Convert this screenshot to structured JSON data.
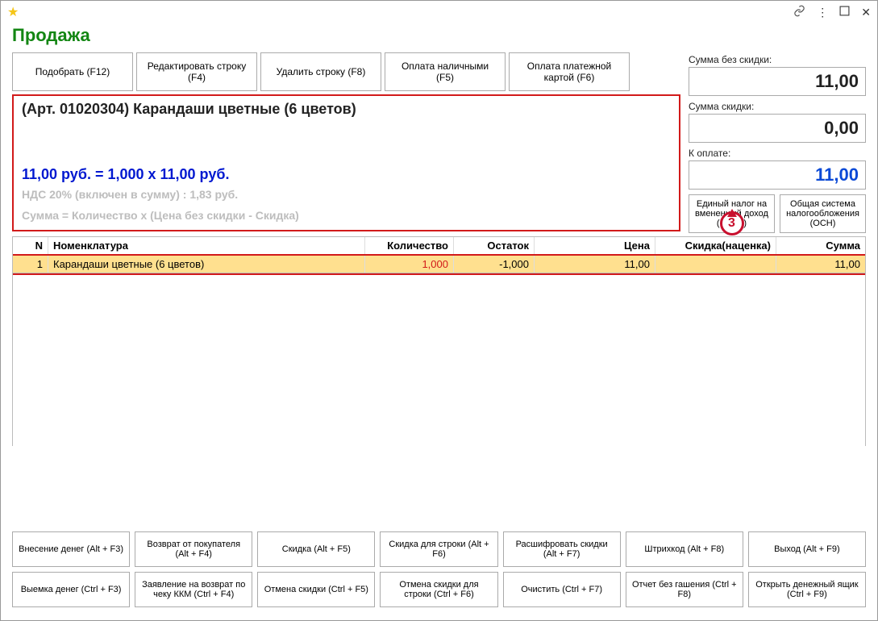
{
  "title": "Продажа",
  "titlebar": {
    "star": "★",
    "link": "⮐",
    "more": "⋮",
    "min": "🗖",
    "close": "✕"
  },
  "topButtons": {
    "pick": "Подобрать (F12)",
    "edit": "Редактировать строку (F4)",
    "delete": "Удалить строку (F8)",
    "cash": "Оплата наличными (F5)",
    "card": "Оплата платежной картой (F6)"
  },
  "info": {
    "title": "(Арт. 01020304) Карандаши цветные (6 цветов)",
    "price_line": "11,00 руб. = 1,000 x 11,00 руб.",
    "vat_line": "НДС 20% (включен в сумму) : 1,83 руб.",
    "formula": "Сумма = Количество x (Цена без скидки - Скидка)"
  },
  "sums": {
    "no_discount_label": "Сумма без скидки:",
    "no_discount_value": "11,00",
    "discount_label": "Сумма скидки:",
    "discount_value": "0,00",
    "total_label": "К оплате:",
    "total_value": "11,00"
  },
  "tax": {
    "envd": "Единый налог на вмененный доход (ЕНВД)",
    "osn": "Общая система налогообложения (ОСН)"
  },
  "callout": "3",
  "grid": {
    "headers": {
      "n": "N",
      "name": "Номенклатура",
      "qty": "Количество",
      "rest": "Остаток",
      "price": "Цена",
      "disc": "Скидка(наценка)",
      "sum": "Сумма"
    },
    "row": {
      "n": "1",
      "name": "Карандаши цветные (6 цветов)",
      "qty": "1,000",
      "rest": "-1,000",
      "price": "11,00",
      "disc": "",
      "sum": "11,00"
    }
  },
  "bottom": {
    "r1": {
      "b1": "Внесение денег (Alt + F3)",
      "b2": "Возврат от покупателя (Alt + F4)",
      "b3": "Скидка (Alt + F5)",
      "b4": "Скидка для строки (Alt + F6)",
      "b5": "Расшифровать скидки (Alt + F7)",
      "b6": "Штрихкод (Alt + F8)",
      "b7": "Выход (Alt + F9)"
    },
    "r2": {
      "b1": "Выемка денег (Ctrl + F3)",
      "b2": "Заявление на возврат по чеку ККМ (Ctrl + F4)",
      "b3": "Отмена скидки (Ctrl + F5)",
      "b4": "Отмена скидки для строки (Ctrl + F6)",
      "b5": "Очистить (Ctrl + F7)",
      "b6": "Отчет без гашения (Ctrl + F8)",
      "b7": "Открыть денежный ящик (Ctrl + F9)"
    }
  }
}
